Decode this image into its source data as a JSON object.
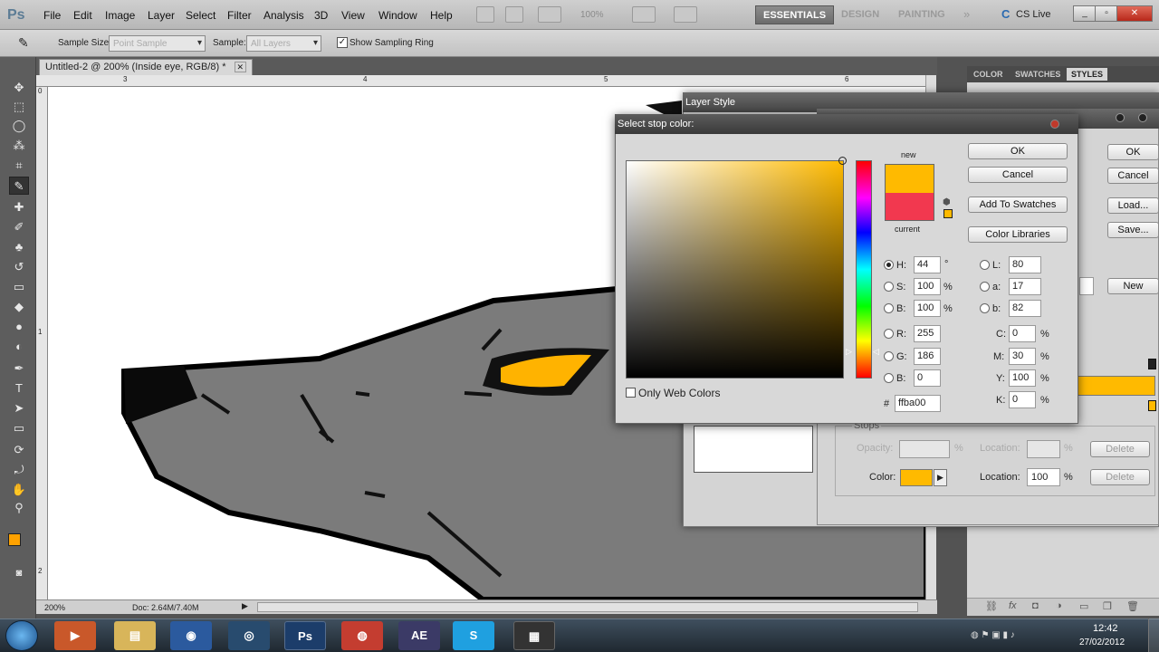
{
  "app": {
    "logo": "Ps"
  },
  "menu": [
    "File",
    "Edit",
    "Image",
    "Layer",
    "Select",
    "Filter",
    "Analysis",
    "3D",
    "View",
    "Window",
    "Help"
  ],
  "appbar": {
    "zoom": "100%",
    "cslive": "CS Live"
  },
  "workspaces": [
    "ESSENTIALS",
    "DESIGN",
    "PAINTING"
  ],
  "options": {
    "sample_size_label": "Sample Size:",
    "sample_size_value": "Point Sample",
    "sample_label": "Sample:",
    "sample_value": "All Layers",
    "show_ring_label": "Show Sampling Ring"
  },
  "document": {
    "tab_title": "Untitled-2 @ 200% (Inside eye, RGB/8) *",
    "ruler_top": [
      "3",
      "4",
      "5",
      "6"
    ],
    "ruler_left": [
      "0",
      "1",
      "2"
    ],
    "zoom": "200%",
    "doc_size": "Doc: 2.64M/7.40M"
  },
  "panels": {
    "tabs": [
      "COLOR",
      "SWATCHES",
      "STYLES"
    ],
    "new_label": "New"
  },
  "layer_style": {
    "title": "Layer Style",
    "ok": "OK",
    "cancel": "Cancel",
    "load": "Load...",
    "save": "Save..."
  },
  "gradient_editor": {
    "stops_label": "Stops",
    "opacity_label": "Opacity:",
    "location_label": "Location:",
    "color_label": "Color:",
    "location_value": "100",
    "percent": "%",
    "delete": "Delete",
    "stop_color": "#ffba00"
  },
  "picker": {
    "title": "Select stop color:",
    "new_label": "new",
    "current_label": "current",
    "ok": "OK",
    "cancel": "Cancel",
    "add_swatches": "Add To Swatches",
    "color_libraries": "Color Libraries",
    "only_web": "Only Web Colors",
    "new_color": "#ffba00",
    "current_color": "#f2384f",
    "hsb": {
      "H": "44",
      "S": "100",
      "B": "100"
    },
    "rgb": {
      "R": "255",
      "G": "186",
      "B": "0"
    },
    "lab": {
      "L": "80",
      "a": "17",
      "b": "82"
    },
    "cmyk": {
      "C": "0",
      "M": "30",
      "Y": "100",
      "K": "0"
    },
    "hex": "ffba00",
    "deg": "°",
    "pct": "%",
    "hash": "#"
  },
  "taskbar": {
    "time": "12:42",
    "date": "27/02/2012",
    "apps": [
      "Ps",
      "AE"
    ]
  },
  "colors": {
    "foreground": "#ffa200",
    "background": "#f2384f"
  }
}
